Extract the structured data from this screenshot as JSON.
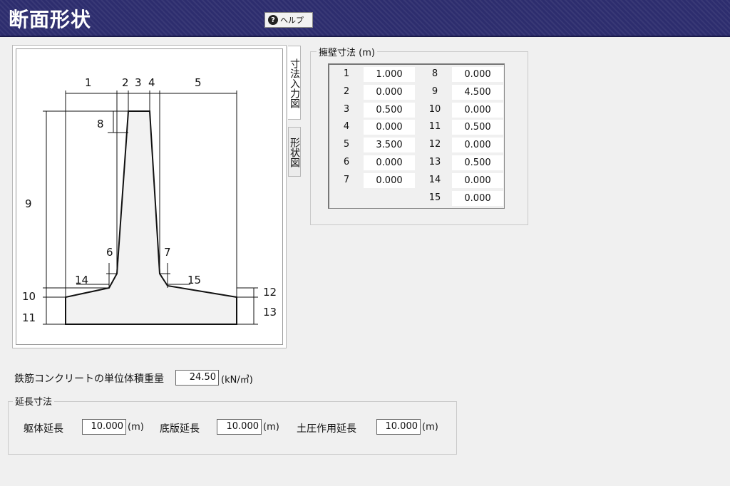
{
  "header": {
    "title": "断面形状",
    "help_label": "ヘルプ",
    "help_icon_glyph": "?",
    "bg_color": "#2d2d6e"
  },
  "tabs": [
    {
      "label": "寸法入力図",
      "active": true
    },
    {
      "label": "形状図",
      "active": false
    }
  ],
  "diagram": {
    "labels": [
      "1",
      "2",
      "3",
      "4",
      "5",
      "6",
      "7",
      "8",
      "9",
      "10",
      "11",
      "12",
      "13",
      "14",
      "15"
    ]
  },
  "dimensions": {
    "title": "擁壁寸法 (m)",
    "rows": [
      {
        "no": "1",
        "value": "1.000"
      },
      {
        "no": "2",
        "value": "0.000"
      },
      {
        "no": "3",
        "value": "0.500"
      },
      {
        "no": "4",
        "value": "0.000"
      },
      {
        "no": "5",
        "value": "3.500"
      },
      {
        "no": "6",
        "value": "0.000"
      },
      {
        "no": "7",
        "value": "0.000"
      },
      {
        "no": "8",
        "value": "0.000"
      },
      {
        "no": "9",
        "value": "4.500"
      },
      {
        "no": "10",
        "value": "0.000"
      },
      {
        "no": "11",
        "value": "0.500"
      },
      {
        "no": "12",
        "value": "0.000"
      },
      {
        "no": "13",
        "value": "0.500"
      },
      {
        "no": "14",
        "value": "0.000"
      },
      {
        "no": "15",
        "value": "0.000"
      }
    ]
  },
  "unit_weight": {
    "label": "鉄筋コンクリートの単位体積重量",
    "value": "24.50",
    "unit": "(kN/㎥)"
  },
  "extension": {
    "title": "延長寸法",
    "fields": [
      {
        "label": "躯体延長",
        "value": "10.000",
        "unit": "(m)"
      },
      {
        "label": "底版延長",
        "value": "10.000",
        "unit": "(m)"
      },
      {
        "label": "土圧作用延長",
        "value": "10.000",
        "unit": "(m)"
      }
    ]
  }
}
